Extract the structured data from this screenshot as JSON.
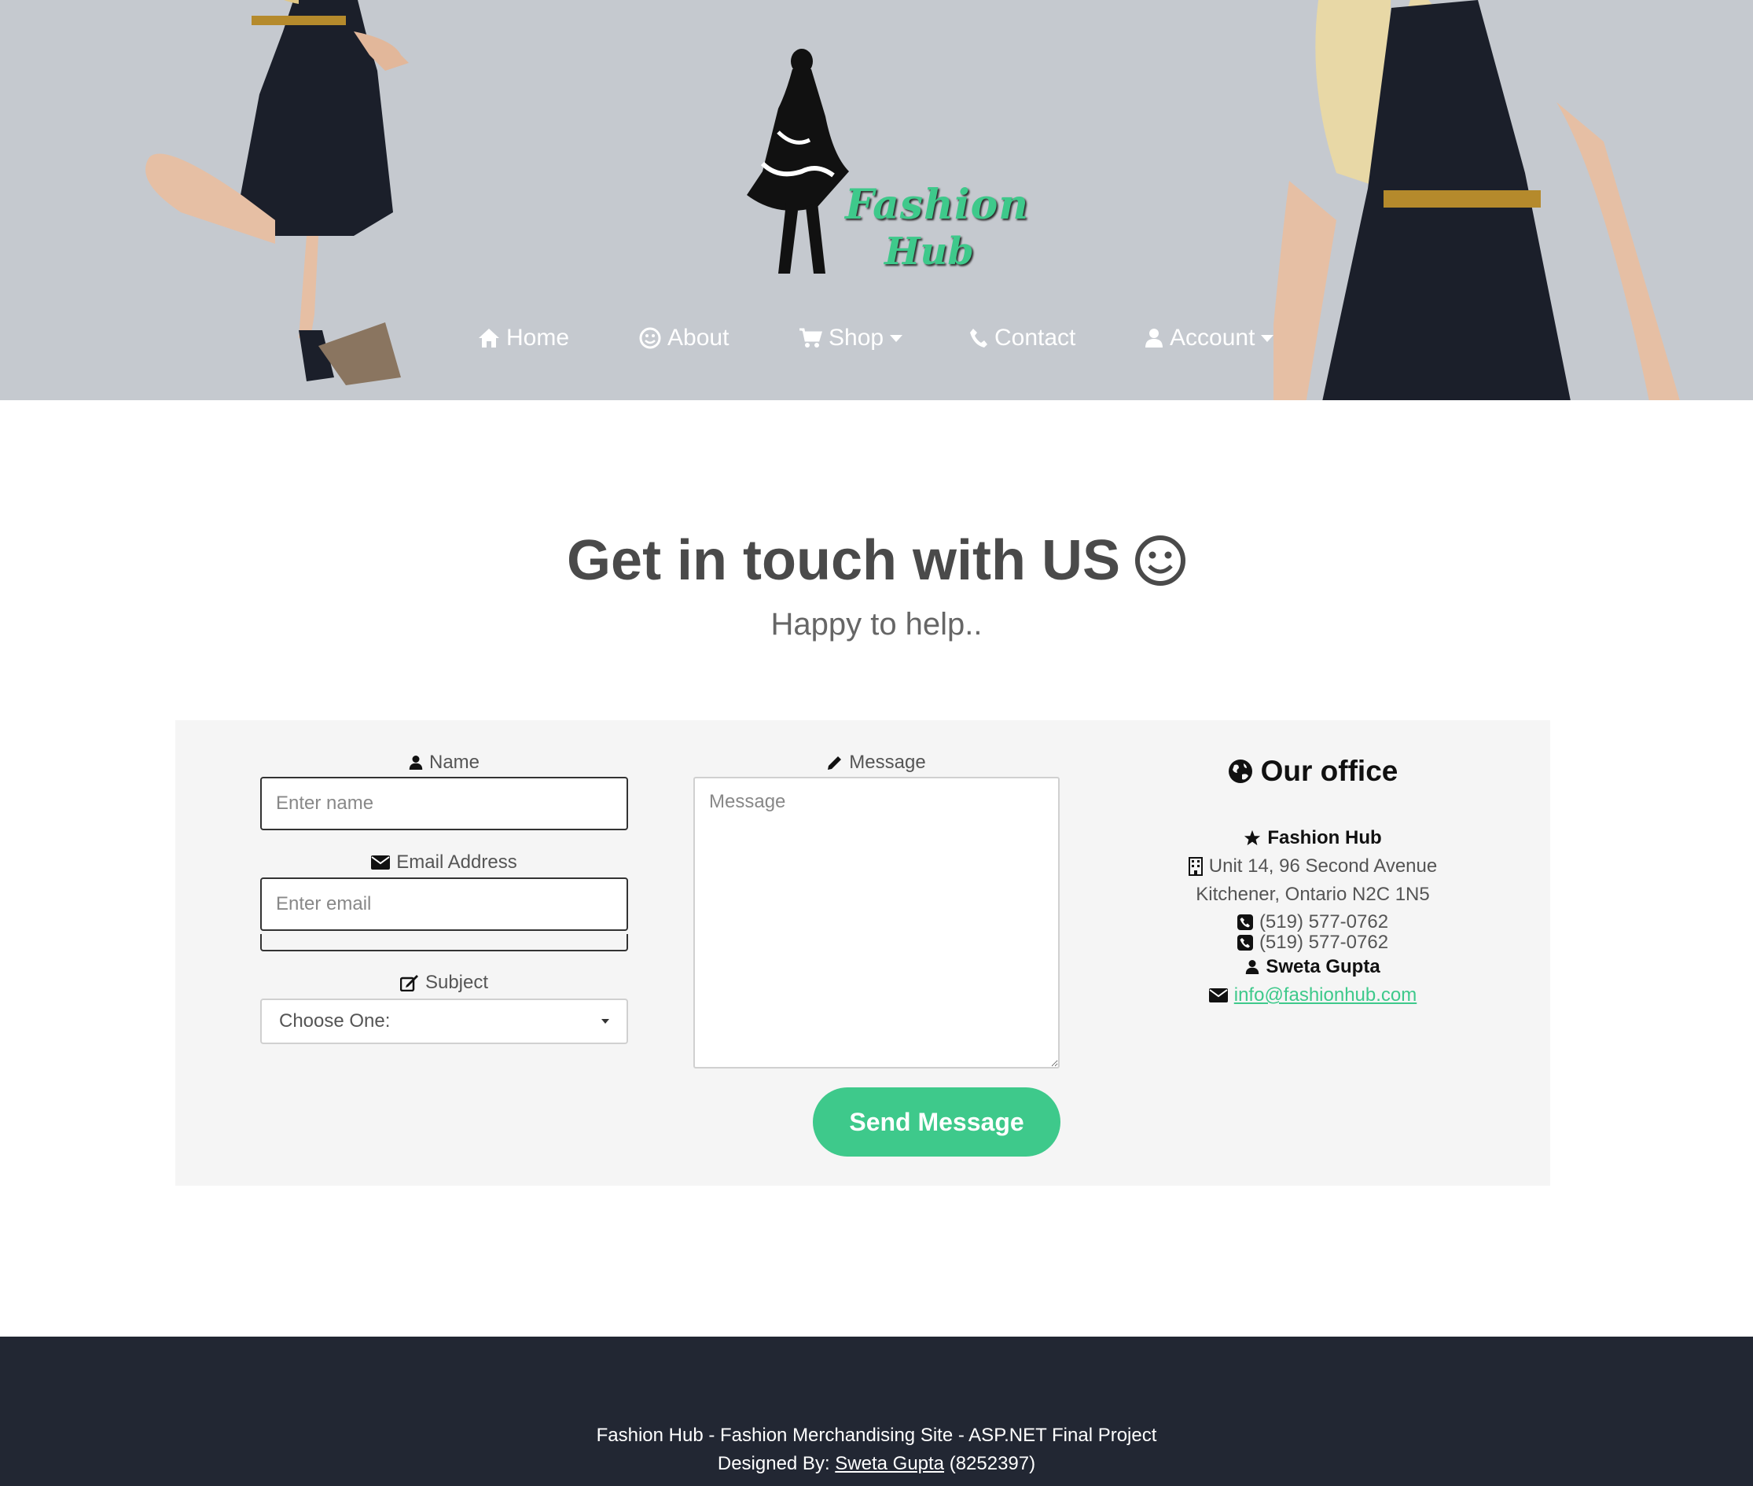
{
  "brand": {
    "line1": "Fashion",
    "line2": "Hub",
    "accent": "#3ec98b"
  },
  "nav": [
    {
      "label": "Home",
      "icon": "home-icon"
    },
    {
      "label": "About",
      "icon": "smile-icon"
    },
    {
      "label": "Shop",
      "icon": "cart-icon",
      "dropdown": true
    },
    {
      "label": "Contact",
      "icon": "phone-icon"
    },
    {
      "label": "Account",
      "icon": "user-icon",
      "dropdown": true
    }
  ],
  "heading": {
    "title": "Get in touch with US",
    "subtitle": "Happy to help.."
  },
  "form": {
    "name_label": "Name",
    "name_placeholder": "Enter name",
    "email_label": "Email Address",
    "email_placeholder": "Enter email",
    "subject_label": "Subject",
    "subject_value": "Choose One:",
    "message_label": "Message",
    "message_placeholder": "Message",
    "send_label": "Send Message"
  },
  "office": {
    "title": "Our office",
    "company": "Fashion Hub",
    "address1": "Unit 14, 96 Second Avenue",
    "address2": "Kitchener, Ontario N2C 1N5",
    "phone1": "(519) 577-0762",
    "phone2": "(519) 577-0762",
    "contact_name": "Sweta Gupta",
    "email": "info@fashionhub.com"
  },
  "footer": {
    "line1": "Fashion Hub - Fashion Merchandising Site - ASP.NET Final Project",
    "designed_by": "Designed By:",
    "designer": "Sweta Gupta",
    "id": "(8252397)"
  }
}
